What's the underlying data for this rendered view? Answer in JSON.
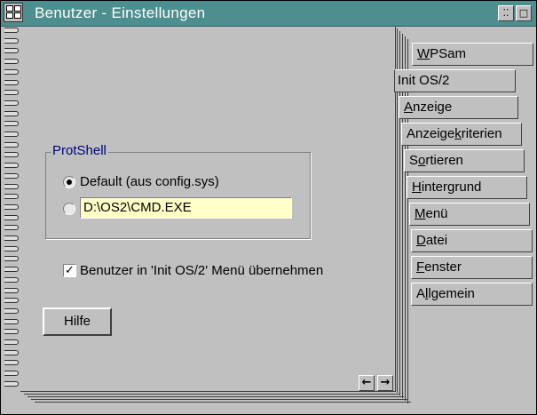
{
  "window": {
    "title": "Benutzer - Einstellungen",
    "restore_glyph": "⁚⁚",
    "maximize_glyph": "□"
  },
  "group": {
    "label": "ProtShell",
    "option_default_label": "Default (aus config.sys)",
    "option_default_selected": true,
    "option_custom_selected": false,
    "custom_path_value": "D:\\OS2\\CMD.EXE"
  },
  "checkbox": {
    "label": "Benutzer in 'Init OS/2' Menü übernehmen",
    "checked": true,
    "glyph": "✓"
  },
  "buttons": {
    "help_label": "Hilfe",
    "prev_glyph": "◆",
    "prev_arrow": "←",
    "next_arrow": "→"
  },
  "tabs": [
    {
      "label": "WPSam",
      "mnemonic_index": 0
    },
    {
      "label": "Init OS/2",
      "mnemonic_index": -1,
      "active": true
    },
    {
      "label": "Anzeige",
      "mnemonic_index": 0
    },
    {
      "label": "Anzeigekriterien",
      "mnemonic_index": 7
    },
    {
      "label": "Sortieren",
      "mnemonic_index": 1
    },
    {
      "label": "Hintergrund",
      "mnemonic_index": 0
    },
    {
      "label": "Menü",
      "mnemonic_index": 0
    },
    {
      "label": "Datei",
      "mnemonic_index": 0
    },
    {
      "label": "Fenster",
      "mnemonic_index": 0
    },
    {
      "label": "Allgemein",
      "mnemonic_index": 1
    }
  ],
  "colors": {
    "titlebar": "#4d8e8e",
    "group_label": "#000080",
    "entry_background": "#ffffc8",
    "face": "#c0c0c0"
  }
}
